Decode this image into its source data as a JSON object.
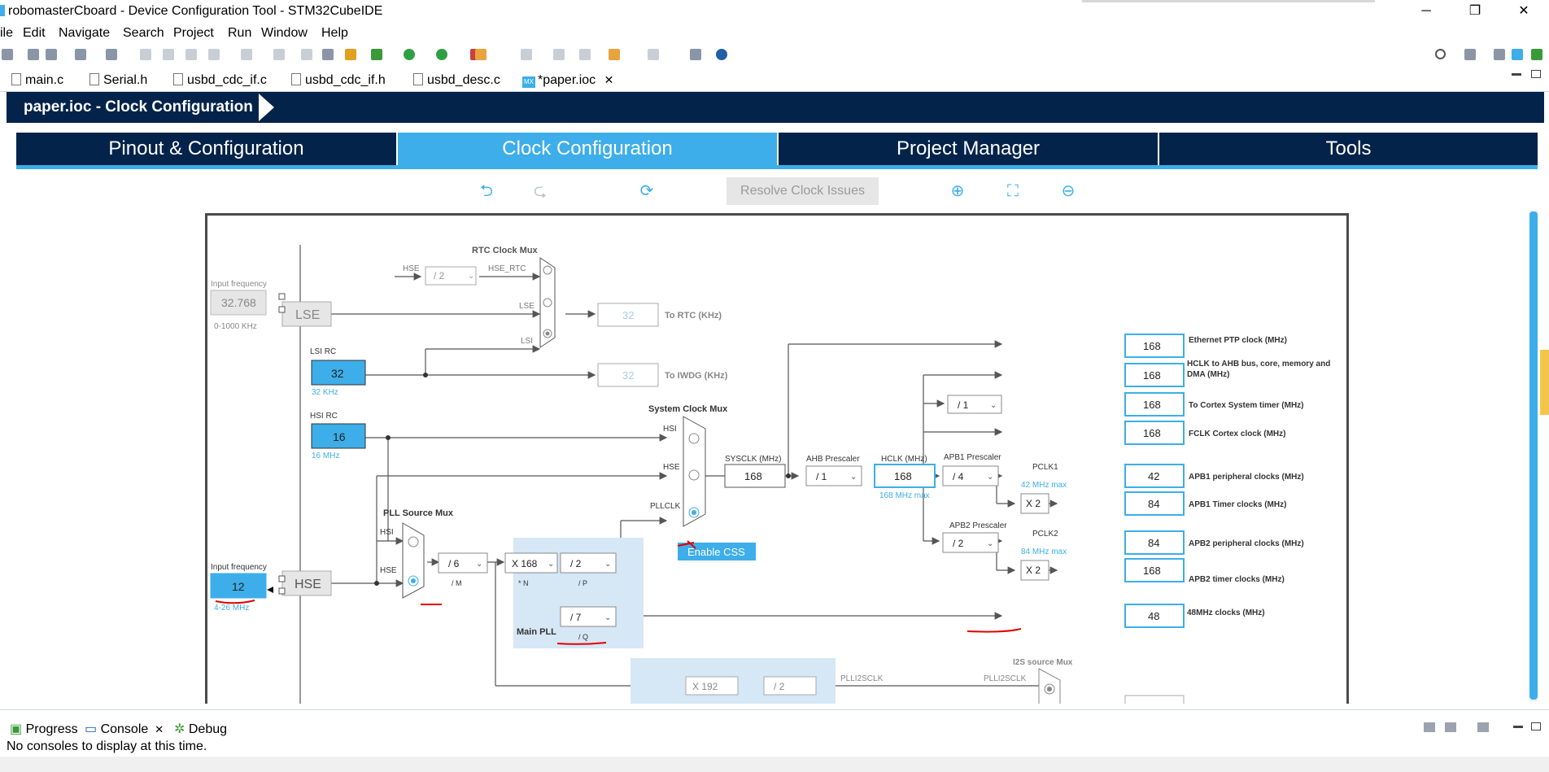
{
  "window": {
    "title": "robomasterCboard - Device Configuration Tool - STM32CubeIDE",
    "minimize": "─",
    "restore": "❐",
    "close": "✕"
  },
  "menu": [
    "ile",
    "Edit",
    "Navigate",
    "Search",
    "Project",
    "Run",
    "Window",
    "Help"
  ],
  "editor_tabs": [
    "main.c",
    "Serial.h",
    "usbd_cdc_if.c",
    "usbd_cdc_if.h",
    "usbd_desc.c",
    "*paper.ioc"
  ],
  "editor_tab_close": "✕",
  "mx_badge": "MX",
  "header": {
    "title": "paper.ioc - Clock Configuration"
  },
  "main_tabs": [
    "Pinout & Configuration",
    "Clock Configuration",
    "Project Manager",
    "Tools"
  ],
  "clock_toolbar": {
    "resolve": "Resolve Clock Issues",
    "undo": "⮌",
    "redo": "⮎",
    "reset": "⟳",
    "zoom_in": "⊕",
    "fit": "⛶",
    "zoom_out": "⊖"
  },
  "diagram": {
    "rtc_mux_title": "RTC Clock Mux",
    "hse_label": "HSE",
    "hse_rtc": "HSE_RTC",
    "rtc_div": "/ 2",
    "lse_in_label": "LSE",
    "lsi_in_label": "LSI",
    "input_freq_label": "Input frequency",
    "lse_value": "32.768",
    "lse_range": "0-1000 KHz",
    "lse_box": "LSE",
    "rtc_out": "32",
    "rtc_label": "To RTC (KHz)",
    "lsi_rc_label": "LSI RC",
    "lsi_value": "32",
    "lsi_khz": "32 KHz",
    "iwdg_out": "32",
    "iwdg_label": "To IWDG (KHz)",
    "hsi_rc_label": "HSI RC",
    "hsi_value": "16",
    "hsi_mhz": "16 MHz",
    "sys_mux_title": "System Clock Mux",
    "sys_hsi": "HSI",
    "sys_hse": "HSE",
    "sys_pllclk": "PLLCLK",
    "sysclk_label": "SYSCLK (MHz)",
    "sysclk_value": "168",
    "ahb_label": "AHB Prescaler",
    "ahb_value": "/ 1",
    "hclk_label": "HCLK (MHz)",
    "hclk_value": "168",
    "hclk_max": "168 MHz max",
    "pll_src_title": "PLL Source Mux",
    "pll_hsi": "HSI",
    "pll_hse": "HSE",
    "hse_input_label": "Input frequency",
    "hse_value": "12",
    "hse_range": "4-26 MHz",
    "hse_box": "HSE",
    "pll_m": "/ 6",
    "m_label": "/ M",
    "pll_n": "X 168",
    "n_label": "* N",
    "pll_p": "/ 2",
    "p_label": "/ P",
    "pll_q": "/ 7",
    "q_label": "/ Q",
    "main_pll": "Main PLL",
    "enable_css": "Enable CSS",
    "cortex_div": "/ 1",
    "apb1_label": "APB1 Prescaler",
    "apb1_value": "/ 4",
    "pclk1": "PCLK1",
    "pclk1_max": "42 MHz max",
    "apb2_label": "APB2 Prescaler",
    "apb2_value": "/ 2",
    "pclk2": "PCLK2",
    "pclk2_max": "84 MHz max",
    "x2a": "X 2",
    "x2b": "X 2",
    "outputs": [
      {
        "value": "168",
        "label": "Ethernet PTP clock (MHz)"
      },
      {
        "value": "168",
        "label": "HCLK to AHB bus, core, memory and DMA (MHz)"
      },
      {
        "value": "168",
        "label": "To Cortex System timer (MHz)"
      },
      {
        "value": "168",
        "label": "FCLK Cortex clock (MHz)"
      },
      {
        "value": "42",
        "label": "APB1 peripheral clocks (MHz)"
      },
      {
        "value": "84",
        "label": "APB1 Timer clocks (MHz)"
      },
      {
        "value": "84",
        "label": "APB2 peripheral clocks (MHz)"
      },
      {
        "value": "168",
        "label": "APB2 timer clocks (MHz)"
      },
      {
        "value": "48",
        "label": "48MHz clocks (MHz)"
      }
    ],
    "plli2s_n": "X 192",
    "plli2s_r": "/ 2",
    "plli2sclk": "PLLI2SCLK",
    "plli2sclk2": "PLLI2SCLK",
    "i2s_mux": "I2S source Mux"
  },
  "bottom_tabs": [
    "Progress",
    "Console",
    "Debug"
  ],
  "console_message": "No consoles to display at this time.",
  "colors": {
    "navy": "#03234b",
    "accent": "#3daee9",
    "input_fill": "#3daee9",
    "disabled_fill": "#e6e6e6",
    "annotation": "#e00000"
  }
}
